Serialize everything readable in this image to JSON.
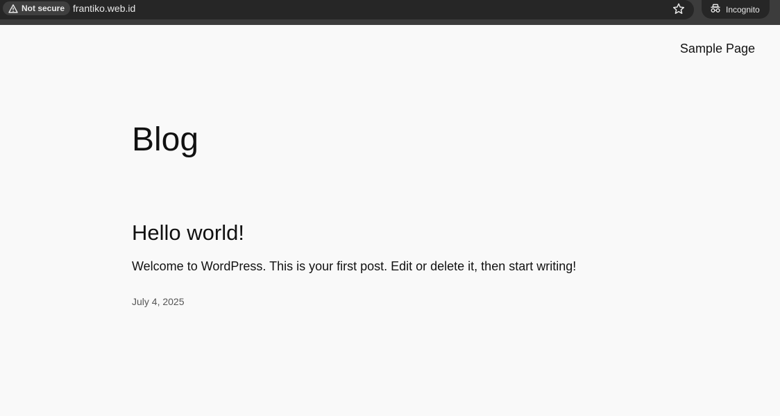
{
  "browser": {
    "security_label": "Not secure",
    "url": "frantiko.web.id",
    "incognito_label": "Incognito"
  },
  "header": {
    "nav_link": "Sample Page"
  },
  "main": {
    "page_title": "Blog",
    "posts": [
      {
        "title": "Hello world!",
        "excerpt": "Welcome to WordPress. This is your first post. Edit or delete it, then start writing!",
        "date": "July 4, 2025"
      }
    ]
  },
  "icons": {
    "security": "warning-triangle-icon",
    "bookmark": "star-icon",
    "incognito": "incognito-icon"
  },
  "colors": {
    "toolbar_bg": "#3c3c3c",
    "omnibox_bg": "#262626",
    "page_bg": "#f9f9f9",
    "text": "#111111"
  }
}
